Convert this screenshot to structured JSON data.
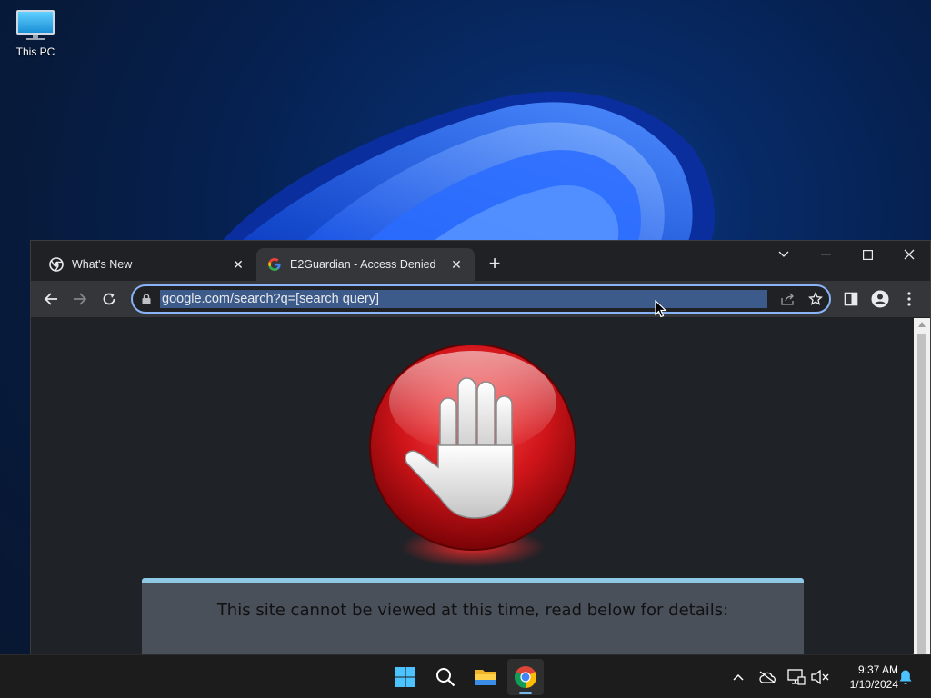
{
  "desktop": {
    "icons": [
      {
        "label": "This PC",
        "icon": "monitor-icon"
      }
    ]
  },
  "browser": {
    "tabs": [
      {
        "title": "What's New",
        "icon": "chrome-icon",
        "active": false
      },
      {
        "title": "E2Guardian - Access Denied",
        "icon": "google-icon",
        "active": true
      }
    ],
    "address_bar": {
      "url": "google.com/search?q=[search query]"
    },
    "page": {
      "message": "This site cannot be viewed at this time, read below for details:",
      "image": "stop-hand-icon"
    }
  },
  "taskbar": {
    "apps": [
      {
        "name": "start",
        "icon": "windows-start-icon"
      },
      {
        "name": "search",
        "icon": "search-icon"
      },
      {
        "name": "file-explorer",
        "icon": "folder-icon"
      },
      {
        "name": "chrome",
        "icon": "chrome-icon",
        "active": true
      }
    ],
    "tray": {
      "time": "9:37 AM",
      "date": "1/10/2024"
    }
  },
  "colors": {
    "accent": "#8ab4f8",
    "block_red": "#d0151a",
    "notice_bar": "#8ecae6"
  }
}
